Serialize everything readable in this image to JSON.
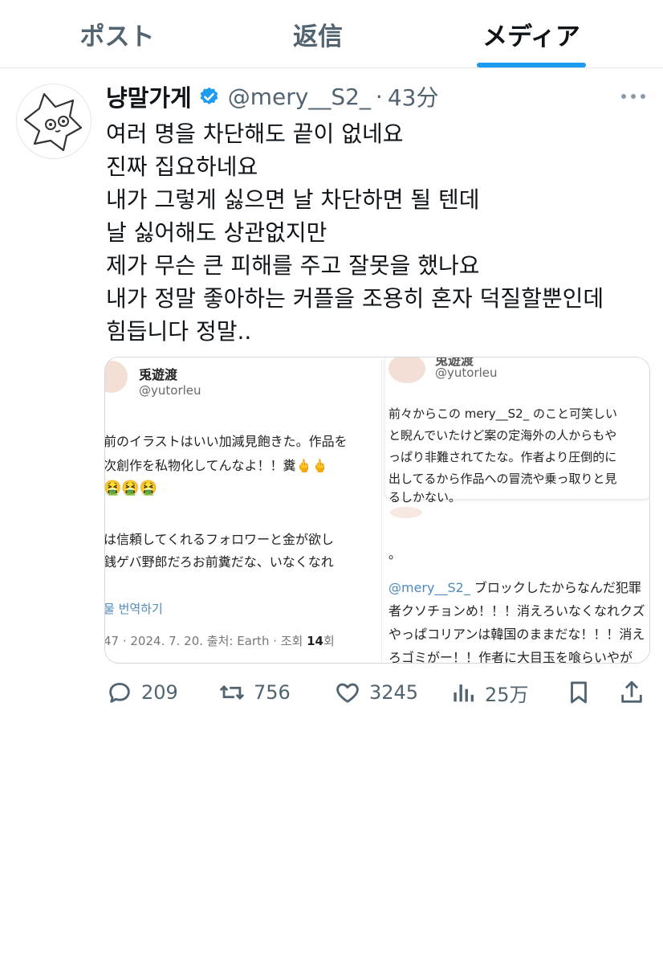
{
  "tabs": [
    {
      "label": "ポスト"
    },
    {
      "label": "返信"
    },
    {
      "label": "メディア"
    }
  ],
  "tweet": {
    "author_name": "냥말가게",
    "handle": "@mery__S2_",
    "separator": "·",
    "time": "43分",
    "verified": true,
    "lines": [
      "여러 명을 차단해도 끝이 없네요",
      "진짜 집요하네요",
      "내가 그렇게 싫으면 날 차단하면 될 텐데",
      "날 싫어해도 상관없지만",
      "제가 무슨 큰 피해를 주고 잘못을 했나요",
      "내가 정말 좋아하는 커플을 조용히 혼자 덕질할뿐인데",
      "힘듭니다 정말.."
    ]
  },
  "media": {
    "left": {
      "name": "兎遊渡",
      "handle": "@yutorleu",
      "lines": [
        "前のイラストはいい加減見飽きた。作品を",
        "次創作を私物化してんなよ！！糞🖕🖕",
        "🤮🤮🤮",
        "は信頼してくれるフォロワーと金が欲し",
        "銭ゲバ野郎だろお前糞だな、いなくなれ"
      ],
      "translate": "물 번역하기",
      "meta_prefix": "47 · 2024. 7. 20. 출처: Earth · 조회 ",
      "meta_views": "14",
      "meta_suffix": "회"
    },
    "right_top": {
      "name": "兎遊渡",
      "handle": "@yutorleu",
      "lines": [
        "前々からこの mery__S2_ のこと可笑しい",
        "と睨んでいたけど案の定海外の人からもや",
        "っぱり非難されてたな。作者より圧倒的に",
        "出してるから作品への冒涜や乗っ取りと見",
        "るしかない。"
      ]
    },
    "right_bottom": {
      "period": "。",
      "mention": "@mery__S2_",
      "first_line_rest": " ブロックしたからなんだ犯罪",
      "lines": [
        "者クソチョンめ！！！消えろいなくなれクズ",
        "やっぱコリアンは韓国のままだな！！！消え",
        "ろゴミがー！！作者に大目玉を喰らいやが"
      ]
    }
  },
  "actions": {
    "replies": "209",
    "reposts": "756",
    "likes": "3245",
    "views": "25万"
  },
  "colors": {
    "accent": "#1d9bf0",
    "muted": "#536471",
    "text": "#0f1419"
  },
  "icons": [
    "verified-badge-icon",
    "more-icon",
    "reply-icon",
    "repost-icon",
    "like-icon",
    "views-icon",
    "bookmark-icon",
    "share-icon"
  ]
}
